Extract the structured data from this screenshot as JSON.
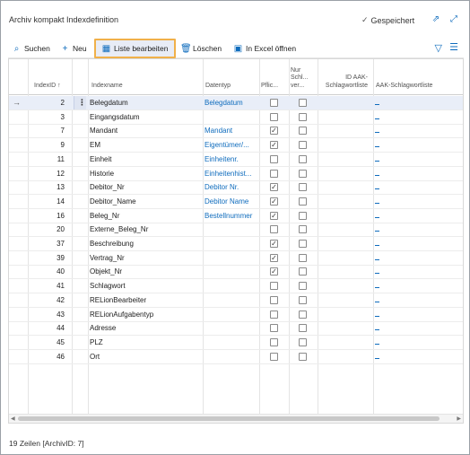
{
  "window": {
    "title": "Archiv kompakt Indexdefinition",
    "saved_label": "Gespeichert"
  },
  "toolbar": {
    "search": "Suchen",
    "new": "Neu",
    "edit_list": "Liste bearbeiten",
    "delete": "Löschen",
    "excel": "In Excel öffnen"
  },
  "columns": {
    "index_id": "IndexID ↑",
    "index_name": "Indexname",
    "data_type": "Datentyp",
    "required": "Pflic...",
    "only_keyword_1": "Nur",
    "only_keyword_2": "Schl...",
    "only_keyword_3": "ver...",
    "aak_id_1": "ID AAK-",
    "aak_id_2": "Schlagwortliste",
    "aak_list": "AAK-Schlagwortliste"
  },
  "rows": [
    {
      "id": "2",
      "name": "Belegdatum",
      "type": "Belegdatum",
      "req": false,
      "only": false,
      "current": true
    },
    {
      "id": "3",
      "name": "Eingangsdatum",
      "type": "",
      "req": false,
      "only": false
    },
    {
      "id": "7",
      "name": "Mandant",
      "type": "Mandant",
      "req": true,
      "only": false
    },
    {
      "id": "9",
      "name": "EM",
      "type": "Eigentümer/...",
      "req": true,
      "only": false
    },
    {
      "id": "11",
      "name": "Einheit",
      "type": "Einheitenr.",
      "req": false,
      "only": false
    },
    {
      "id": "12",
      "name": "Historie",
      "type": "Einheitenhist...",
      "req": false,
      "only": false
    },
    {
      "id": "13",
      "name": "Debitor_Nr",
      "type": "Debitor Nr.",
      "req": true,
      "only": false
    },
    {
      "id": "14",
      "name": "Debitor_Name",
      "type": "Debitor Name",
      "req": true,
      "only": false
    },
    {
      "id": "16",
      "name": "Beleg_Nr",
      "type": "Bestellnummer",
      "req": true,
      "only": false
    },
    {
      "id": "20",
      "name": "Externe_Beleg_Nr",
      "type": "",
      "req": false,
      "only": false
    },
    {
      "id": "37",
      "name": "Beschreibung",
      "type": "",
      "req": true,
      "only": false
    },
    {
      "id": "39",
      "name": "Vertrag_Nr",
      "type": "",
      "req": true,
      "only": false
    },
    {
      "id": "40",
      "name": "Objekt_Nr",
      "type": "",
      "req": true,
      "only": false
    },
    {
      "id": "41",
      "name": "Schlagwort",
      "type": "",
      "req": false,
      "only": false
    },
    {
      "id": "42",
      "name": "RELionBearbeiter",
      "type": "",
      "req": false,
      "only": false
    },
    {
      "id": "43",
      "name": "RELionAufgabentyp",
      "type": "",
      "req": false,
      "only": false
    },
    {
      "id": "44",
      "name": "Adresse",
      "type": "",
      "req": false,
      "only": false
    },
    {
      "id": "45",
      "name": "PLZ",
      "type": "",
      "req": false,
      "only": false
    },
    {
      "id": "46",
      "name": "Ort",
      "type": "",
      "req": false,
      "only": false
    }
  ],
  "footer": {
    "status": "19 Zeilen [ArchivID: 7]"
  },
  "colors": {
    "accent": "#0f6cbd",
    "highlight_border": "#f0b04a",
    "selected_row": "#e9eef8"
  },
  "icons": [
    "check-icon",
    "share-icon",
    "expand-icon",
    "search-icon",
    "plus-icon",
    "edit-list-icon",
    "trash-icon",
    "excel-icon",
    "filter-icon",
    "list-menu-icon",
    "row-arrow-icon",
    "more-options-icon"
  ]
}
